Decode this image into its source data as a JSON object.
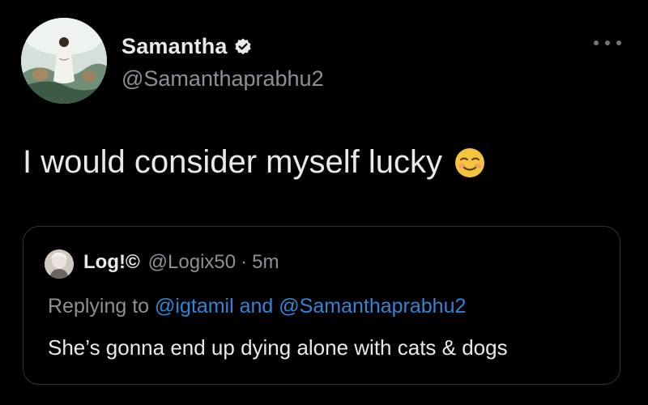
{
  "tweet": {
    "author": {
      "name": "Samantha",
      "handle": "@Samanthaprabhu2",
      "verified": true,
      "avatar_icon": "profile-avatar"
    },
    "more_icon": "more-options-icon",
    "text": "I would consider myself lucky",
    "emoji": "smiling-face-with-blush-emoji"
  },
  "quoted_tweet": {
    "author_name": "Log!©",
    "handle": "@Logix50",
    "separator": "·",
    "time": "5m",
    "replying_prefix": "Replying to",
    "replying_mention_1": "@igtamil",
    "replying_and": "and",
    "replying_mention_2": "@Samanthaprabhu2",
    "text": "She’s gonna end up dying alone with cats & dogs"
  },
  "colors": {
    "background": "#000000",
    "text_primary": "#e7e9ea",
    "text_secondary": "#8b9097",
    "link": "#2f86d6",
    "border": "#2f3336"
  }
}
